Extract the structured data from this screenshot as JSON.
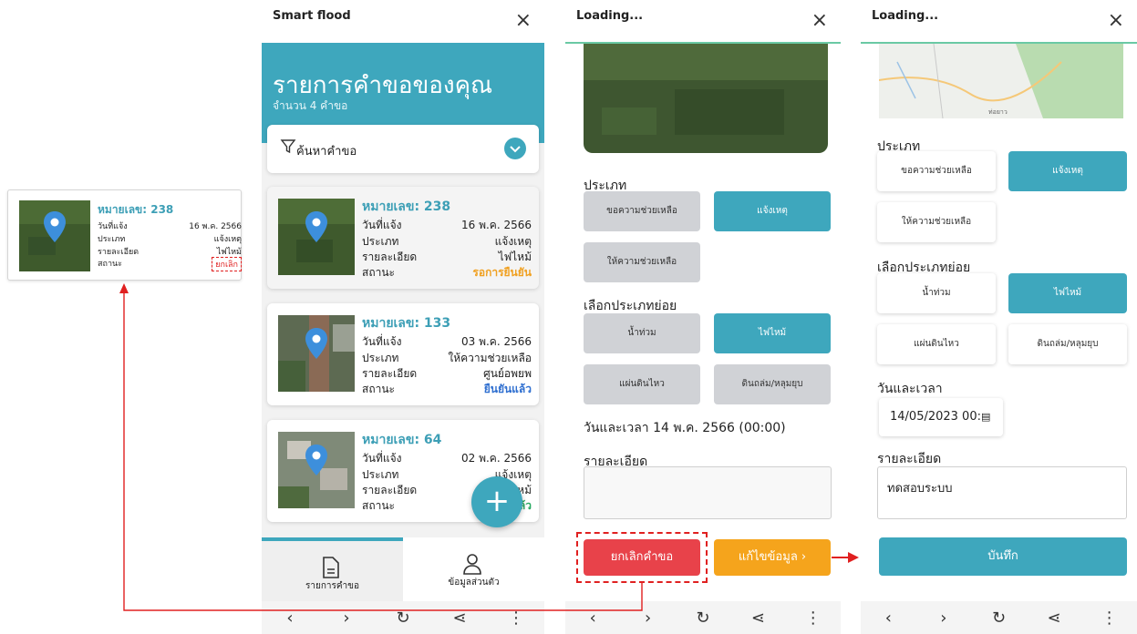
{
  "mini_card": {
    "title": "หมายเลข: 238",
    "rows": [
      {
        "label": "วันที่แจ้ง",
        "value": "16 พ.ค. 2566"
      },
      {
        "label": "ประเภท",
        "value": "แจ้งเหตุ"
      },
      {
        "label": "รายละเอียด",
        "value": "ไฟไหม้"
      },
      {
        "label": "สถานะ",
        "value": "ยกเลิก"
      }
    ]
  },
  "phone1": {
    "app_title": "Smart flood",
    "close": "×",
    "header_title": "รายการคำขอของคุณ",
    "header_sub": "จำนวน 4 คำขอ",
    "search_label": "ค้นหาคำขอ",
    "cards": [
      {
        "title": "หมายเลข: 238",
        "rows": [
          {
            "label": "วันที่แจ้ง",
            "value": "16 พ.ค. 2566"
          },
          {
            "label": "ประเภท",
            "value": "แจ้งเหตุ"
          },
          {
            "label": "รายละเอียด",
            "value": "ไฟไหม้"
          },
          {
            "label": "สถานะ",
            "value": "รอการยืนยัน"
          }
        ]
      },
      {
        "title": "หมายเลข: 133",
        "rows": [
          {
            "label": "วันที่แจ้ง",
            "value": "03 พ.ค. 2566"
          },
          {
            "label": "ประเภท",
            "value": "ให้ความช่วยเหลือ"
          },
          {
            "label": "รายละเอียด",
            "value": "ศูนย์อพยพ"
          },
          {
            "label": "สถานะ",
            "value": "ยืนยันแล้ว"
          }
        ]
      },
      {
        "title": "หมายเลข: 64",
        "rows": [
          {
            "label": "วันที่แจ้ง",
            "value": "02 พ.ค. 2566"
          },
          {
            "label": "ประเภท",
            "value": "แจ้งเหตุ"
          },
          {
            "label": "รายละเอียด",
            "value": "ไฟไหม้"
          },
          {
            "label": "สถานะ",
            "value": "ยืนยันแล้ว"
          }
        ]
      }
    ],
    "fab": "+",
    "tabs": [
      "รายการคำขอ",
      "ข้อมูลส่วนตัว"
    ]
  },
  "phone2": {
    "app_title": "Loading...",
    "close": "×",
    "type_label": "ประเภท",
    "types": [
      "ขอความช่วยเหลือ",
      "แจ้งเหตุ",
      "ให้ความช่วยเหลือ"
    ],
    "subtype_label": "เลือกประเภทย่อย",
    "subtypes": [
      "น้ำท่วม",
      "ไฟไหม้",
      "แผ่นดินไหว",
      "ดินถล่ม/หลุมยุบ"
    ],
    "datetime_text": "วันและเวลา 14 พ.ค. 2566 (00:00)",
    "detail_label": "รายละเอียด",
    "cancel_button": "ยกเลิกคำขอ",
    "edit_button": "แก้ไขข้อมูล"
  },
  "phone3": {
    "app_title": "Loading...",
    "close": "×",
    "map_label": "ท่อยาว",
    "type_label": "ประเภท",
    "types": [
      "ขอความช่วยเหลือ",
      "แจ้งเหตุ",
      "ให้ความช่วยเหลือ"
    ],
    "subtype_label": "เลือกประเภทย่อย",
    "subtypes": [
      "น้ำท่วม",
      "ไฟไหม้",
      "แผ่นดินไหว",
      "ดินถล่ม/หลุมยุบ"
    ],
    "datetime_label": "วันและเวลา",
    "datetime_value": "14/05/2023 00:",
    "detail_label": "รายละเอียด",
    "detail_value": "ทดสอบระบบ",
    "save_button": "บันทึก"
  },
  "nav_icons": [
    "back-icon",
    "forward-icon",
    "refresh-icon",
    "share-icon",
    "more-icon"
  ],
  "colors": {
    "teal": "#3ea7bd",
    "red": "#e8424a",
    "orange": "#f5a41c",
    "green_line": "#6ac9a4",
    "arrow_red": "#e02020"
  }
}
